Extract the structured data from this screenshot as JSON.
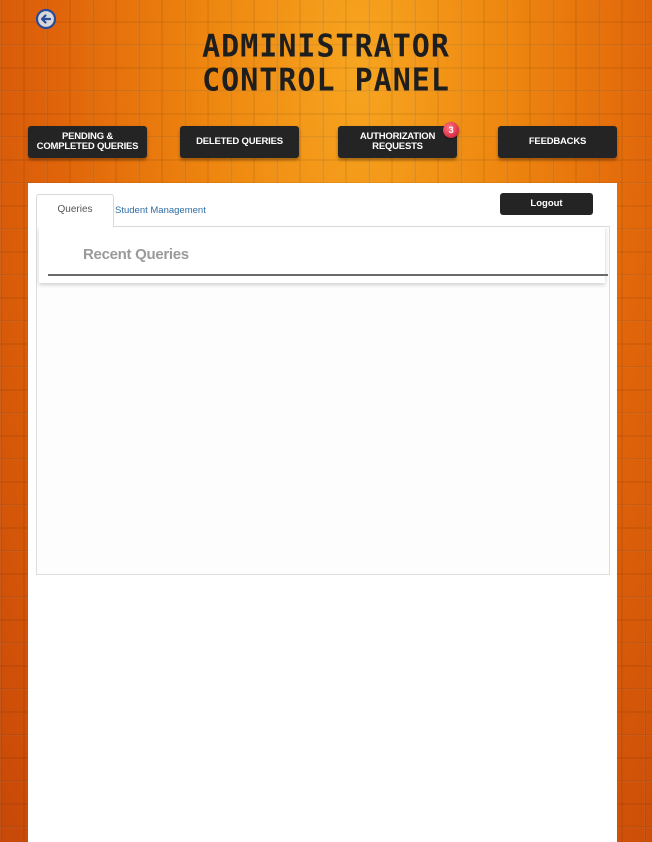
{
  "header": {
    "title_line1": "ADMINISTRATOR",
    "title_line2": "CONTROL PANEL",
    "back_icon": "arrow-left-circle-icon"
  },
  "nav": [
    {
      "label": "PENDING & COMPLETED QUERIES"
    },
    {
      "label": "DELETED QUERIES"
    },
    {
      "label": "AUTHORIZATION REQUESTS",
      "badge": "3"
    },
    {
      "label": "FEEDBACKS"
    }
  ],
  "tabs": {
    "queries": "Queries",
    "student_management": "Student Management"
  },
  "logout_label": "Logout",
  "recent": {
    "title": "Recent Queries"
  },
  "colors": {
    "accent": "#e26a0a",
    "button": "#242424",
    "badge": "#e23a52",
    "link": "#2e6da4"
  }
}
